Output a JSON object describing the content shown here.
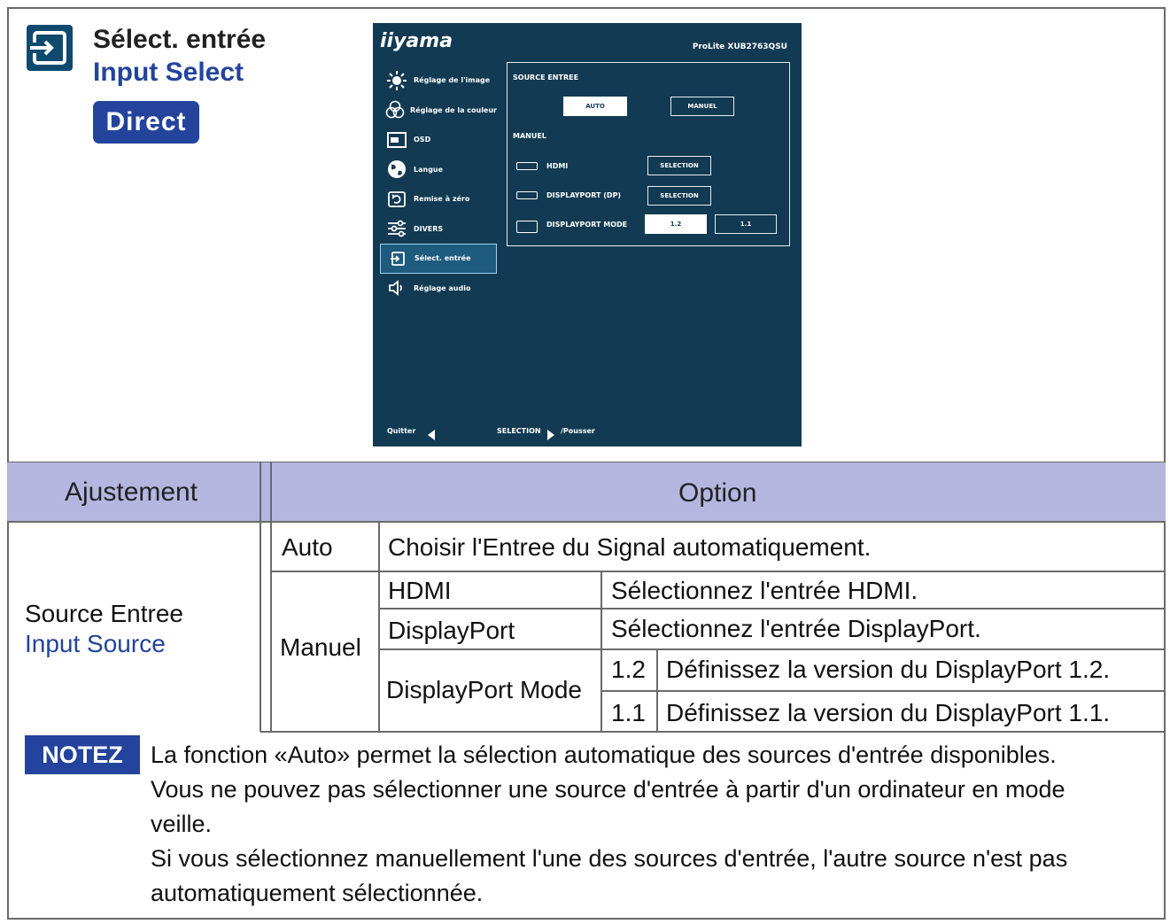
{
  "header": {
    "title_fr": "Sélect. entrée",
    "title_en": "Input Select",
    "badge": "Direct"
  },
  "osd": {
    "logo": "iiyama",
    "model": "ProLite XUB2763QSU",
    "menu": [
      {
        "label": "Réglage de l'image",
        "icon": "brightness-icon"
      },
      {
        "label": "Réglage de la couleur",
        "icon": "color-icon"
      },
      {
        "label": "OSD",
        "icon": "osd-icon"
      },
      {
        "label": "Langue",
        "icon": "globe-icon"
      },
      {
        "label": "Remise à zéro",
        "icon": "reset-icon"
      },
      {
        "label": "DIVERS",
        "icon": "settings-icon"
      },
      {
        "label": "Sélect. entrée",
        "icon": "input-icon"
      },
      {
        "label": "Réglage audio",
        "icon": "speaker-icon"
      }
    ],
    "source_title": "SOURCE ENTREE",
    "auto_label": "AUTO",
    "manual_label": "MANUEL",
    "manual_title": "MANUEL",
    "hdmi_label": "HDMI",
    "dp_label": "DISPLAYPORT (DP)",
    "dp_mode_label": "DISPLAYPORT MODE",
    "selection_label": "SELECTION",
    "mode_12": "1.2",
    "mode_11": "1.1",
    "footer_quit": "Quitter",
    "footer_select": "SELECTION",
    "footer_push": "/Pousser"
  },
  "table": {
    "col_adjust": "Ajustement",
    "col_option": "Option",
    "row_label_fr": "Source Entree",
    "row_label_en": "Input Source",
    "auto": "Auto",
    "auto_desc": "Choisir l'Entree du Signal automatiquement.",
    "manual": "Manuel",
    "hdmi": "HDMI",
    "hdmi_desc": "Sélectionnez l'entrée HDMI.",
    "displayport": "DisplayPort",
    "displayport_desc": "Sélectionnez l'entrée DisplayPort.",
    "dp_mode": "DisplayPort Mode",
    "v12": "1.2",
    "v12_desc": "Définissez la version du DisplayPort 1.2.",
    "v11": "1.1",
    "v11_desc": "Définissez la version du DisplayPort 1.1."
  },
  "note": {
    "label": "NOTEZ",
    "lines": [
      "La fonction «Auto» permet la sélection automatique des sources d'entrée disponibles.",
      "Vous ne pouvez pas sélectionner une source d'entrée à partir d'un ordinateur en mode",
      "veille.",
      "Si vous sélectionnez manuellement l'une des sources d'entrée, l'autre source n'est pas",
      "automatiquement sélectionnée."
    ]
  },
  "colors": {
    "accent_blue": "#23439c",
    "header_band": "#b5b6e0",
    "osd_background": "#123a52"
  }
}
